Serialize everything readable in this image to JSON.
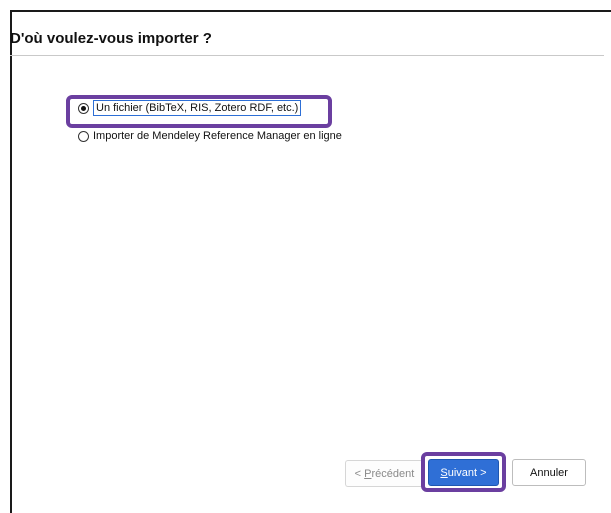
{
  "dialog": {
    "title": "D'où voulez-vous importer ?"
  },
  "options": [
    {
      "label": "Un fichier (BibTeX, RIS, Zotero RDF, etc.)",
      "selected": true
    },
    {
      "label": "Importer de Mendeley Reference Manager en ligne",
      "selected": false
    }
  ],
  "buttons": {
    "prev_mnemonic": "P",
    "prev_prefix": "< ",
    "prev_rest": "récédent",
    "next_mnemonic": "S",
    "next_rest": "uivant >",
    "cancel": "Annuler"
  },
  "colors": {
    "highlight": "#6b3fa0",
    "primary_button": "#2f6fd6",
    "focus_outline": "#2d6fd6"
  }
}
